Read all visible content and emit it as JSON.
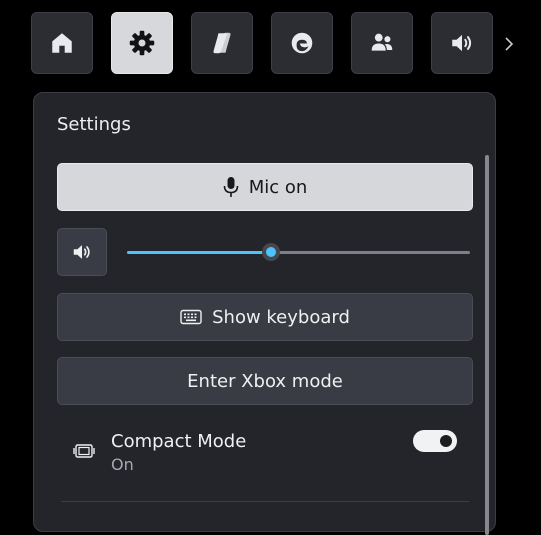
{
  "topbar": {
    "tabs": [
      {
        "icon": "home-icon",
        "active": false
      },
      {
        "icon": "gear-icon",
        "active": true
      },
      {
        "icon": "copilot-icon",
        "active": false
      },
      {
        "icon": "edge-browser-icon",
        "active": false
      },
      {
        "icon": "people-icon",
        "active": false
      },
      {
        "icon": "speaker-icon",
        "active": false
      }
    ],
    "next_icon": "chevron-right-icon"
  },
  "settings": {
    "title": "Settings",
    "mic_button": {
      "label": "Mic on",
      "icon": "microphone-icon"
    },
    "volume": {
      "icon": "speaker-icon",
      "value_percent": 42
    },
    "keyboard_button": {
      "label": "Show keyboard",
      "icon": "keyboard-icon"
    },
    "xbox_button": {
      "label": "Enter Xbox mode"
    },
    "compact_mode": {
      "label": "Compact Mode",
      "status": "On",
      "enabled": true,
      "icon": "compact-mode-icon"
    }
  },
  "colors": {
    "accent": "#4cc2ff",
    "panel_bg": "#23252a",
    "button_dark": "#393c44",
    "button_light": "#d5d7db"
  }
}
